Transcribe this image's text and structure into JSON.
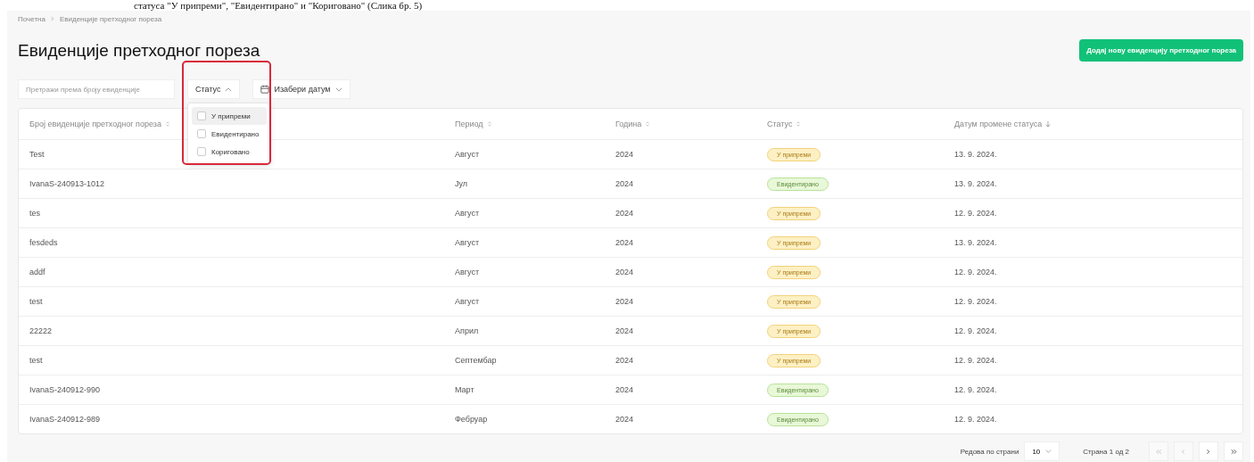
{
  "doc_caption": "статуса \"У припреми\", \"Евидентирано\" и \"Кориговано\" (Слика бр. 5)",
  "breadcrumb": [
    "Почетна",
    "Евиденције претходног пореза"
  ],
  "title": "Евиденције претходног пореза",
  "add_button": "Додај нову евиденцију претходног пореза",
  "search": {
    "placeholder": "Претражи према броју евиденције"
  },
  "status_filter": {
    "label": "Статус",
    "expanded": true,
    "options": [
      {
        "label": "У припреми",
        "checked": false,
        "highlighted": true
      },
      {
        "label": "Евидентирано",
        "checked": false,
        "highlighted": false
      },
      {
        "label": "Кориговано",
        "checked": false,
        "highlighted": false
      }
    ]
  },
  "date_filter": {
    "label": "Изабери датум"
  },
  "table": {
    "columns": [
      {
        "label": "Број евиденције претходног пореза",
        "sorted": false
      },
      {
        "label": "Период",
        "sorted": false
      },
      {
        "label": "Година",
        "sorted": false
      },
      {
        "label": "Статус",
        "sorted": false
      },
      {
        "label": "Датум промене статуса",
        "sorted": true
      }
    ],
    "rows": [
      {
        "number": "Test",
        "period": "Август",
        "year": "2024",
        "status": "У припреми",
        "kind": "draft",
        "date": "13. 9. 2024."
      },
      {
        "number": "IvanaS-240913-1012",
        "period": "Јул",
        "year": "2024",
        "status": "Евидентирано",
        "kind": "recorded",
        "date": "13. 9. 2024."
      },
      {
        "number": "tes",
        "period": "Август",
        "year": "2024",
        "status": "У припреми",
        "kind": "draft",
        "date": "12. 9. 2024."
      },
      {
        "number": "fesdeds",
        "period": "Август",
        "year": "2024",
        "status": "У припреми",
        "kind": "draft",
        "date": "13. 9. 2024."
      },
      {
        "number": "addf",
        "period": "Август",
        "year": "2024",
        "status": "У припреми",
        "kind": "draft",
        "date": "12. 9. 2024."
      },
      {
        "number": "test",
        "period": "Август",
        "year": "2024",
        "status": "У припреми",
        "kind": "draft",
        "date": "12. 9. 2024."
      },
      {
        "number": "22222",
        "period": "Април",
        "year": "2024",
        "status": "У припреми",
        "kind": "draft",
        "date": "12. 9. 2024."
      },
      {
        "number": "test",
        "period": "Септембар",
        "year": "2024",
        "status": "У припреми",
        "kind": "draft",
        "date": "12. 9. 2024."
      },
      {
        "number": "IvanaS-240912-990",
        "period": "Март",
        "year": "2024",
        "status": "Евидентирано",
        "kind": "recorded",
        "date": "12. 9. 2024."
      },
      {
        "number": "IvanaS-240912-989",
        "period": "Фебруар",
        "year": "2024",
        "status": "Евидентирано",
        "kind": "recorded",
        "date": "12. 9. 2024."
      }
    ]
  },
  "pagination": {
    "rows_label": "Редова по страни",
    "rows_value": "10",
    "page_label": "Страна 1 од 2",
    "buttons": [
      {
        "kind": "first",
        "disabled": true
      },
      {
        "kind": "prev",
        "disabled": true
      },
      {
        "kind": "next",
        "disabled": false
      },
      {
        "kind": "last",
        "disabled": false
      }
    ]
  }
}
